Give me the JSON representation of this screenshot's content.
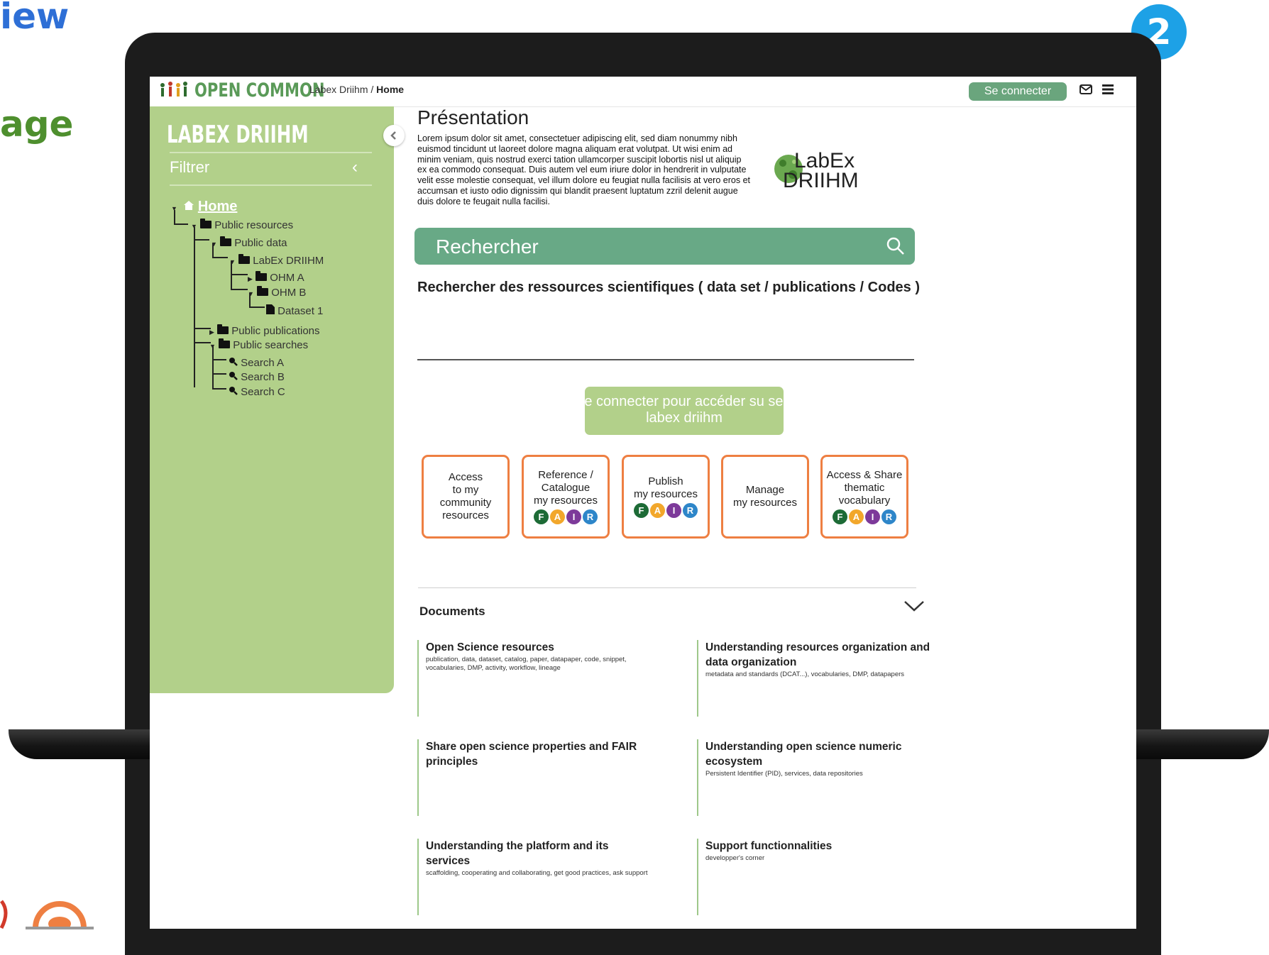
{
  "slide": {
    "fragment_top": "iew",
    "fragment_mid": "age",
    "step_badge": "2"
  },
  "header": {
    "app_name": "OPEN COMMON",
    "breadcrumb_parent": "Labex Driihm",
    "breadcrumb_separator": "/",
    "breadcrumb_current": "Home",
    "login_label": "Se connecter",
    "icons": [
      "mail-icon",
      "menu-icon"
    ]
  },
  "sidebar": {
    "title": "LABEX DRIIHM",
    "filter_label": "Filtrer",
    "tree": {
      "home": "Home",
      "public_resources": "Public resources",
      "public_data": "Public data",
      "labex_driihm": "LabEx DRIIHM",
      "ohm_a": "OHM A",
      "ohm_b": "OHM B",
      "dataset_1": "Dataset 1",
      "public_publications": "Public publications",
      "public_searches": "Public searches",
      "search_a": "Search A",
      "search_b": "Search B",
      "search_c": "Search C"
    }
  },
  "presentation": {
    "title": "Présentation",
    "body": "Lorem ipsum dolor sit amet, consectetuer adipiscing elit, sed diam nonummy nibh euismod tincidunt ut laoreet dolore magna aliquam erat volutpat. Ut wisi enim ad minim veniam, quis nostrud exerci tation ullamcorper suscipit lobortis nisl ut aliquip ex ea commodo consequat. Duis autem vel eum iriure dolor in hendrerit in vulputate velit esse molestie consequat, vel illum dolore eu feugiat nulla facilisis at vero eros et accumsan et iusto odio dignissim qui blandit praesent luptatum zzril delenit augue duis dolore te feugait nulla facilisi.",
    "logo_line1": "LabEx",
    "logo_line2": "DRIIHM"
  },
  "search": {
    "placeholder": "Rechercher",
    "subtitle": "Rechercher des ressources scientifiques ( data set / publications / Codes )"
  },
  "service_button": {
    "line1": "Se connecter pour accéder su service d",
    "line2": "labex driihm"
  },
  "cards": [
    {
      "label": "Access\nto my\ncommunity\nresources"
    },
    {
      "label": "Reference /\nCatalogue\nmy resources"
    },
    {
      "label": "Publish\nmy resources"
    },
    {
      "label": "Manage\nmy resources"
    },
    {
      "label": "Access & Share\nthematic\nvocabulary"
    }
  ],
  "fair_badges": {
    "letters": [
      "F",
      "A",
      "I",
      "R"
    ],
    "colors": [
      "#1d6b36",
      "#f2a72b",
      "#7d3a9a",
      "#2e86c9"
    ]
  },
  "documents": {
    "title": "Documents",
    "items": [
      {
        "title": "Open Science resources",
        "subtitle": "publication, data, dataset, catalog, paper, datapaper, code, snippet, vocabularies, DMP, activity, workflow, lineage"
      },
      {
        "title": "Understanding resources organization and data organization",
        "subtitle": "metadata and standards (DCAT...), vocabularies, DMP, datapapers"
      },
      {
        "title": "Share open science properties and FAIR principles",
        "subtitle": ""
      },
      {
        "title": "Understanding open science numeric ecosystem",
        "subtitle": "Persistent Identifier (PID), services, data repositories"
      },
      {
        "title": "Understanding the platform and its services",
        "subtitle": "scaffolding, cooperating and collaborating, get good practices, ask support"
      },
      {
        "title": "Support functionnalities",
        "subtitle": "developper's corner"
      }
    ]
  },
  "colors": {
    "sidebar": "#b2d08a",
    "search_bar": "#68a986",
    "card_border": "#ee7f42",
    "accent_blue": "#1da1e6"
  }
}
